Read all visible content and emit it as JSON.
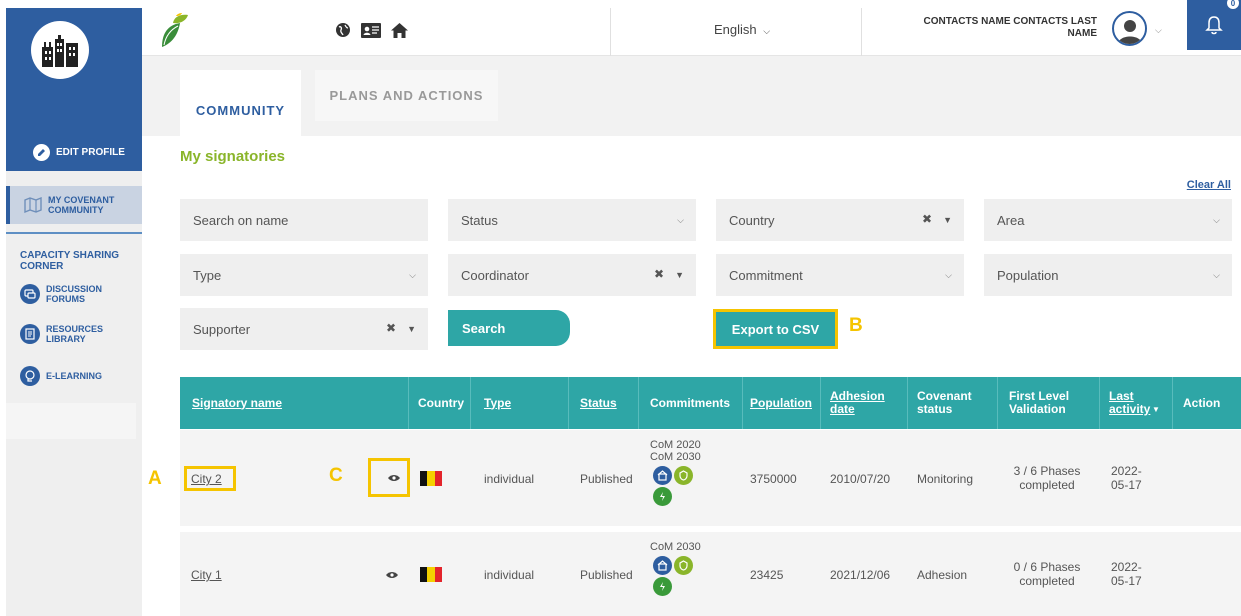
{
  "header": {
    "language": "English",
    "user_name": "CONTACTS NAME CONTACTS LAST NAME",
    "notification_count": "0"
  },
  "sidebar": {
    "edit_profile": "EDIT PROFILE",
    "my_covenant_community": "MY COVENANT COMMUNITY",
    "capacity_section": "CAPACITY SHARING CORNER",
    "discussion_forums": "DISCUSSION FORUMS",
    "resources_library": "RESOURCES LIBRARY",
    "e_learning": "E-LEARNING"
  },
  "tabs": [
    {
      "label": "COMMUNITY",
      "active": true
    },
    {
      "label": "PLANS AND ACTIONS",
      "active": false
    }
  ],
  "page_title": "My signatories",
  "clear_all": "Clear All",
  "filters": {
    "search_name": "Search on name",
    "status": "Status",
    "country": "Country",
    "area": "Area",
    "type": "Type",
    "coordinator": "Coordinator",
    "commitment": "Commitment",
    "population": "Population",
    "supporter": "Supporter"
  },
  "buttons": {
    "search": "Search",
    "export_csv": "Export to CSV"
  },
  "annotations": {
    "a": "A",
    "b": "B",
    "c": "C"
  },
  "table": {
    "headers": [
      "Signatory name",
      "Country",
      "Type",
      "Status",
      "Commitments",
      "Population",
      "Adhesion date",
      "Covenant status",
      "First Level Validation",
      "Last activity",
      "Action"
    ],
    "rows": [
      {
        "name": "City 2",
        "country": "Belgium",
        "type": "individual",
        "status": "Published",
        "commitments": [
          "CoM 2020",
          "CoM 2030"
        ],
        "population": "3750000",
        "adhesion": "2010/07/20",
        "covenant": "Monitoring",
        "validation": "3 / 6 Phases completed",
        "activity": "2022-05-17"
      },
      {
        "name": "City 1",
        "country": "Belgium",
        "type": "individual",
        "status": "Published",
        "commitments": [
          "CoM 2030"
        ],
        "population": "23425",
        "adhesion": "2021/12/06",
        "covenant": "Adhesion",
        "validation": "0 / 6 Phases completed",
        "activity": "2022-05-17"
      }
    ]
  },
  "colors": {
    "brand_blue": "#2e5ea0",
    "teal": "#2ea6a6",
    "green": "#8ab52a",
    "highlight": "#f5c400"
  }
}
